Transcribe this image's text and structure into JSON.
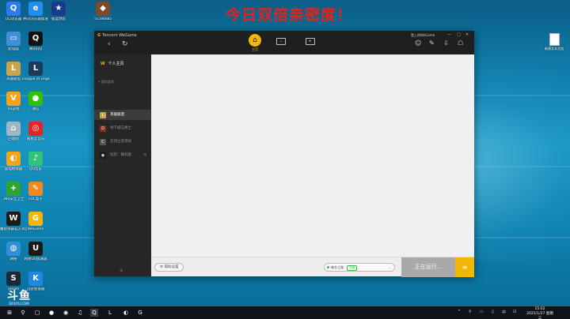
{
  "overlay": {
    "text": "今日双倍亲密度！"
  },
  "desktop": {
    "icons": [
      {
        "label": "QQ浏览器",
        "color": "#2b7bf3",
        "glyph": "Q"
      },
      {
        "label": "腾讯浏览器加速",
        "color": "#1f8ef1",
        "glyph": "e"
      },
      {
        "label": "极度伪装",
        "color": "#1a3b8a",
        "glyph": "★"
      },
      {
        "label": "TE584885",
        "color": "#7a4a2a",
        "glyph": "◆"
      },
      {
        "label": "此电脑",
        "color": "#3e8fd8",
        "glyph": "▭"
      },
      {
        "label": "腾讯QQ",
        "color": "#111111",
        "glyph": "Q"
      },
      {
        "label": "英雄联盟",
        "color": "#c9a44a",
        "glyph": "L"
      },
      {
        "label": "League of Legends",
        "color": "#1c3b5a",
        "glyph": "L"
      },
      {
        "label": "VS游戏",
        "color": "#f5a31a",
        "glyph": "V"
      },
      {
        "label": "微信",
        "color": "#2dc100",
        "glyph": "●"
      },
      {
        "label": "回收站",
        "color": "#9fb6c7",
        "glyph": "⌂"
      },
      {
        "label": "网易云音乐",
        "color": "#e0262a",
        "glyph": "◎"
      },
      {
        "label": "雷电模拟器",
        "color": "#f5a31a",
        "glyph": "◐"
      },
      {
        "label": "QQ音乐",
        "color": "#31c27c",
        "glyph": "♪"
      },
      {
        "label": "360安全卫士",
        "color": "#2fa52f",
        "glyph": "+"
      },
      {
        "label": "LOL盒子",
        "color": "#f08a1c",
        "glyph": "✎"
      },
      {
        "label": "魔兽争霸官方对战平台",
        "color": "#1b1b1b",
        "glyph": "W"
      },
      {
        "label": "WeGame",
        "color": "#f2b705",
        "glyph": "G"
      },
      {
        "label": "网络",
        "color": "#2f8fd8",
        "glyph": "◍"
      },
      {
        "label": "网易UU加速器",
        "color": "#1a1a1a",
        "glyph": "U"
      },
      {
        "label": "Steam",
        "color": "#1b2838",
        "glyph": "S"
      },
      {
        "label": "迅游加速器",
        "color": "#1e88e5",
        "glyph": "K"
      }
    ],
    "right_file": {
      "label": "新建文本文档"
    },
    "watermark": {
      "big": "斗鱼",
      "small": "DOUYU.COM"
    }
  },
  "app": {
    "brand": "Tencent WeGame",
    "brand_glyph": "G",
    "nav": {
      "back": "‹",
      "refresh": "↻"
    },
    "tabs": [
      {
        "label": "主页",
        "glyph": "⌂"
      }
    ],
    "account": "登上的WeGame",
    "window_controls": [
      "—",
      "□",
      "✕"
    ],
    "tools": [
      "☺",
      "✎",
      "⇩",
      "☖"
    ],
    "sidebar": {
      "home": "个人主页",
      "home_glyph": "W",
      "section_label": "• 我的游戏",
      "items": [
        {
          "label": "英雄联盟",
          "color": "#c9a44a",
          "glyph": "L"
        },
        {
          "label": "地下城与勇士",
          "color": "#8a2c1c",
          "glyph": "D"
        },
        {
          "label": "云顶之弈测试",
          "color": "#555555",
          "glyph": "C"
        },
        {
          "label": "饥荒：联机版",
          "color": "#1a1a1a",
          "glyph": "◉",
          "more": "⊡"
        }
      ],
      "bottom_icon": "⊕"
    },
    "footer": {
      "assist": "辅助设置",
      "assist_glyph": "⚙",
      "accel_text": "確非之路",
      "accel_badge": "加速",
      "accel_chevron": "⌄",
      "run_label": "正在运行...",
      "menu_glyph": "≡"
    }
  },
  "taskbar": {
    "start": "⊞",
    "search": "⚲",
    "apps": [
      "▢",
      "●",
      "◉",
      "♫",
      "Q",
      "L",
      "◐",
      "G"
    ],
    "tray": [
      "^",
      "⚲",
      "▭",
      "♫",
      "中",
      "⊡"
    ],
    "time": "15:02",
    "date": "2021/1/27 星期三"
  }
}
